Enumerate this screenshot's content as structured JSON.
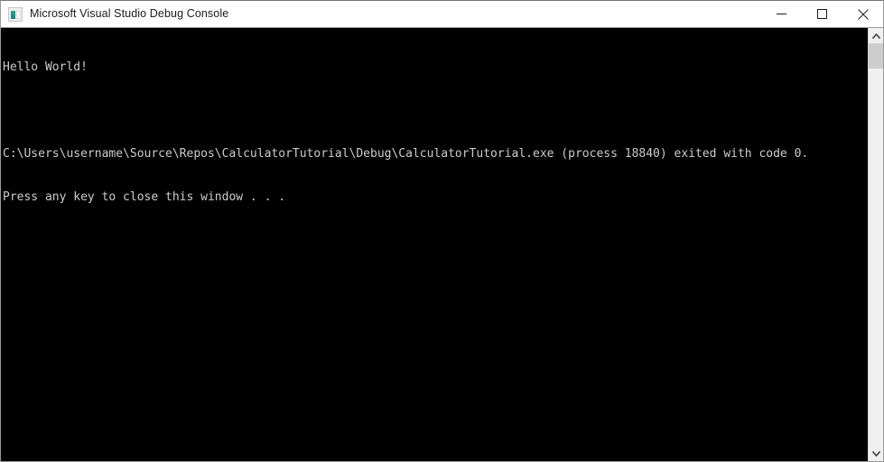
{
  "window": {
    "title": "Microsoft Visual Studio Debug Console",
    "icon": "console-app-icon",
    "colors": {
      "titlebar_bg": "#ffffff",
      "title_text": "#1b1b1b",
      "console_bg": "#000000",
      "console_text": "#cccccc",
      "window_border": "#9a9a9a",
      "scrollbar_track": "#f0f0f0",
      "scrollbar_thumb": "#cdcdcd"
    }
  },
  "caption_buttons": [
    {
      "name": "minimize-button",
      "icon": "minimize-icon",
      "label": "Minimize"
    },
    {
      "name": "maximize-button",
      "icon": "maximize-icon",
      "label": "Maximize"
    },
    {
      "name": "close-button",
      "icon": "close-icon",
      "label": "Close"
    }
  ],
  "console": {
    "lines": [
      "Hello World!",
      "",
      "C:\\Users\\username\\Source\\Repos\\CalculatorTutorial\\Debug\\CalculatorTutorial.exe (process 18840) exited with code 0.",
      "Press any key to close this window . . ."
    ],
    "program_output": "Hello World!",
    "executable_path": "C:\\Users\\username\\Source\\Repos\\CalculatorTutorial\\Debug\\CalculatorTutorial.exe",
    "process_id": "18840",
    "exit_code": "0",
    "prompt": "Press any key to close this window . . ."
  },
  "scrollbar": {
    "up_arrow": "chevron-up-icon",
    "down_arrow": "chevron-down-icon",
    "thumb_position": "top"
  }
}
